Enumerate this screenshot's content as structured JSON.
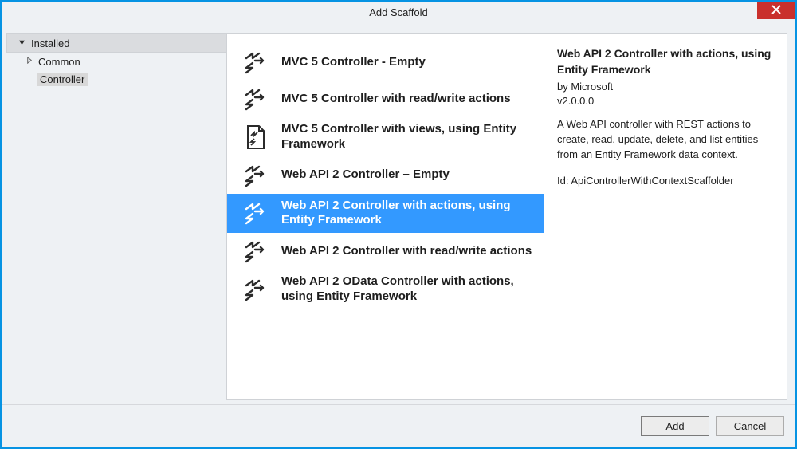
{
  "window": {
    "title": "Add Scaffold"
  },
  "tree": {
    "root": "Installed",
    "common": "Common",
    "controller": "Controller"
  },
  "items": [
    {
      "label": "MVC 5 Controller - Empty",
      "icon": "controller",
      "selected": false
    },
    {
      "label": "MVC 5 Controller with read/write actions",
      "icon": "controller",
      "selected": false
    },
    {
      "label": "MVC 5 Controller with views, using Entity Framework",
      "icon": "views",
      "selected": false
    },
    {
      "label": "Web API 2 Controller – Empty",
      "icon": "controller",
      "selected": false
    },
    {
      "label": "Web API 2 Controller with actions, using Entity Framework",
      "icon": "controller",
      "selected": true
    },
    {
      "label": "Web API 2 Controller with read/write actions",
      "icon": "controller",
      "selected": false
    },
    {
      "label": "Web API 2 OData Controller with actions, using Entity Framework",
      "icon": "controller",
      "selected": false
    }
  ],
  "details": {
    "title": "Web API 2 Controller with actions, using Entity Framework",
    "by": "by Microsoft",
    "version": "v2.0.0.0",
    "description": "A Web API controller with REST actions to create, read, update, delete, and list entities from an Entity Framework data context.",
    "id": "Id: ApiControllerWithContextScaffolder"
  },
  "buttons": {
    "add": "Add",
    "cancel": "Cancel"
  }
}
